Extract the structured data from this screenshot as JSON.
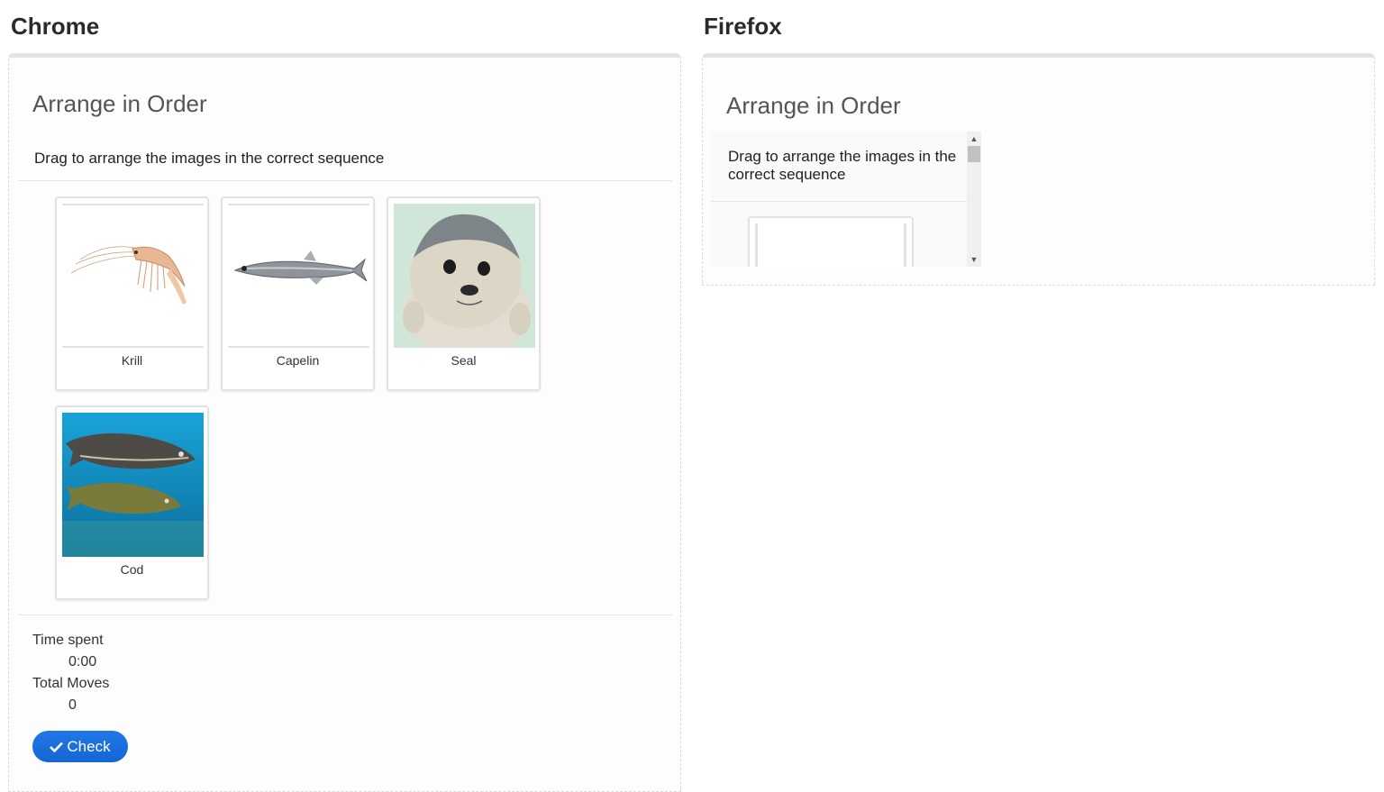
{
  "chrome": {
    "heading": "Chrome",
    "title": "Arrange in Order",
    "instructions": "Drag to arrange the images in the correct sequence",
    "cards": [
      {
        "label": "Krill",
        "image": "krill-image"
      },
      {
        "label": "Capelin",
        "image": "capelin-image"
      },
      {
        "label": "Seal",
        "image": "seal-image"
      },
      {
        "label": "Cod",
        "image": "cod-image"
      }
    ],
    "time_label": "Time spent",
    "time_value": "0:00",
    "moves_label": "Total Moves",
    "moves_value": "0",
    "check_label": "Check",
    "check_icon": "checkmark-icon"
  },
  "firefox": {
    "heading": "Firefox",
    "title": "Arrange in Order",
    "instructions": "Drag to arrange the images in the correct sequence"
  },
  "colors": {
    "accent": "#1a73e8",
    "panel_border": "#e3e3e3"
  }
}
